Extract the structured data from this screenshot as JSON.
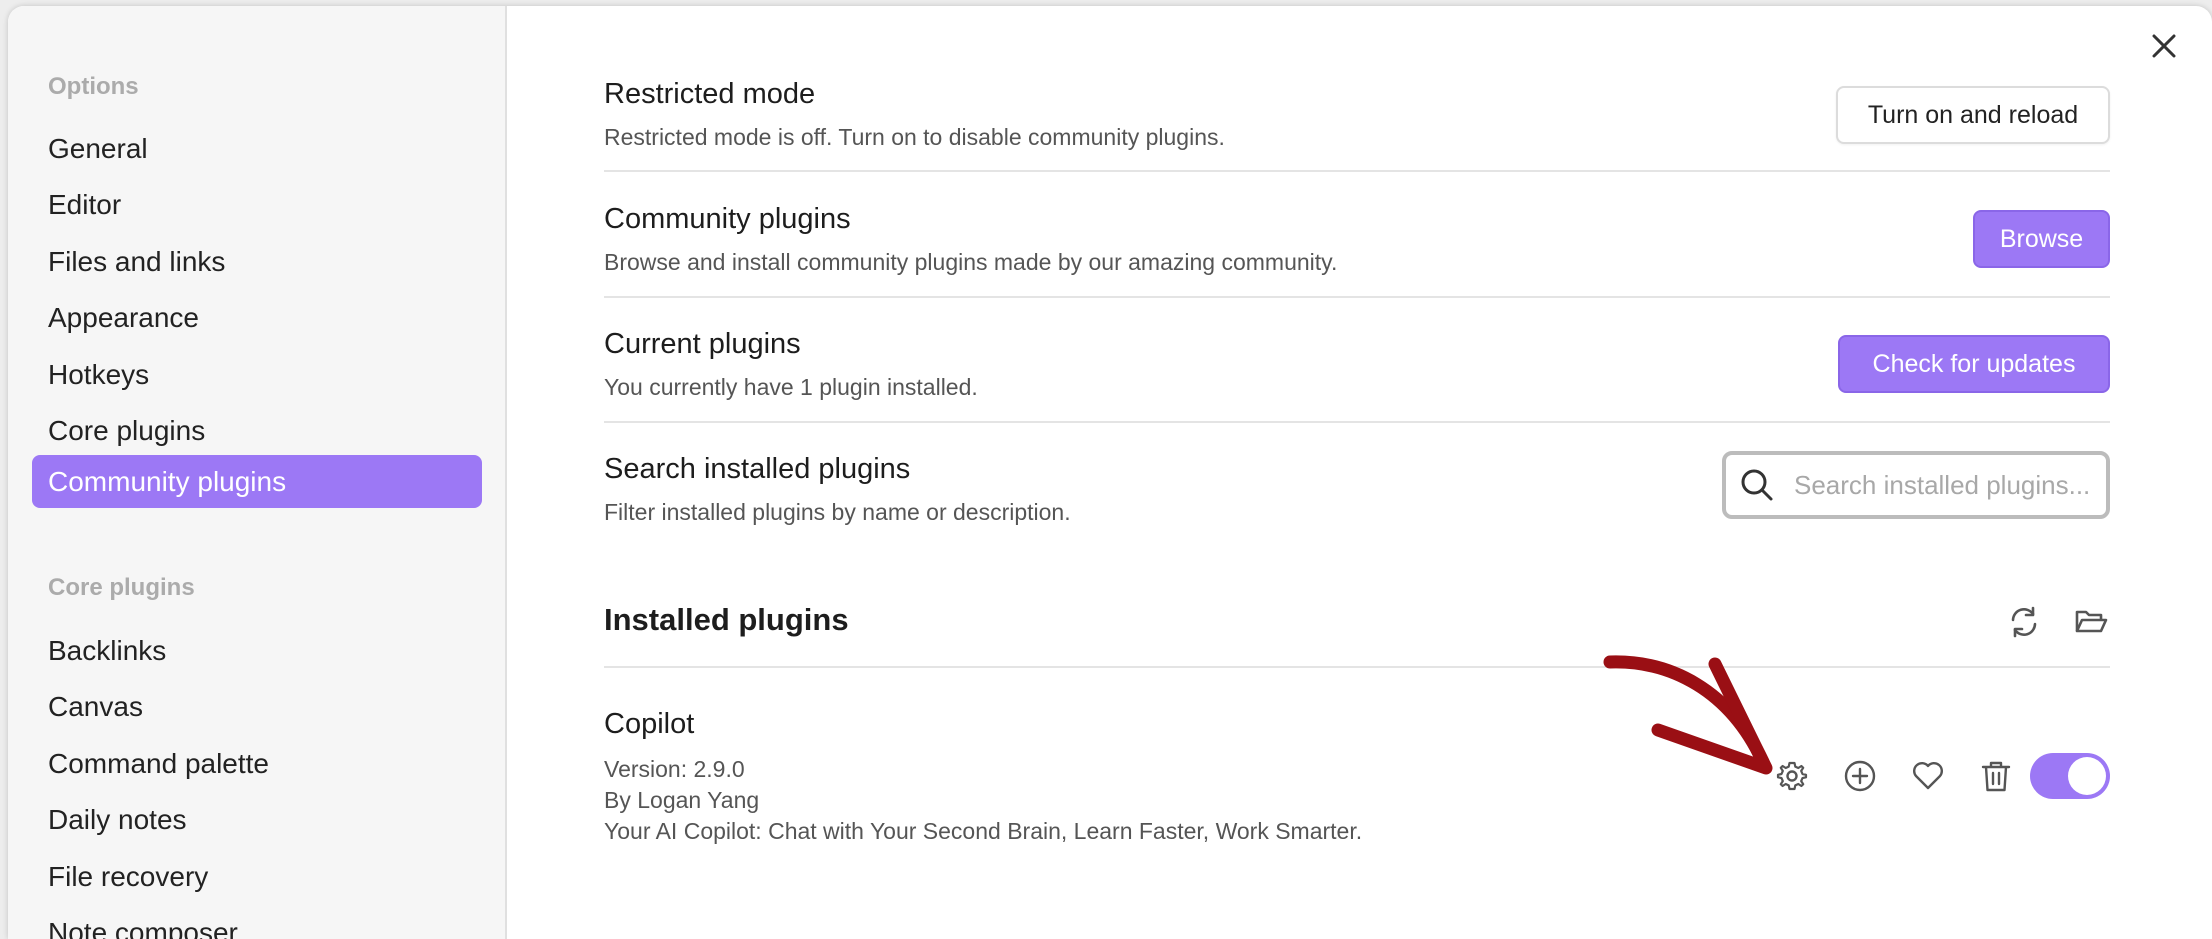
{
  "sidebar": {
    "options_heading": "Options",
    "options_items": [
      {
        "label": "General"
      },
      {
        "label": "Editor"
      },
      {
        "label": "Files and links"
      },
      {
        "label": "Appearance"
      },
      {
        "label": "Hotkeys"
      },
      {
        "label": "Core plugins"
      },
      {
        "label": "Community plugins",
        "active": true
      }
    ],
    "core_heading": "Core plugins",
    "core_items": [
      {
        "label": "Backlinks"
      },
      {
        "label": "Canvas"
      },
      {
        "label": "Command palette"
      },
      {
        "label": "Daily notes"
      },
      {
        "label": "File recovery"
      },
      {
        "label": "Note composer"
      }
    ]
  },
  "settings": {
    "restricted": {
      "name": "Restricted mode",
      "desc": "Restricted mode is off. Turn on to disable community plugins.",
      "button": "Turn on and reload"
    },
    "community": {
      "name": "Community plugins",
      "desc": "Browse and install community plugins made by our amazing community.",
      "button": "Browse"
    },
    "current": {
      "name": "Current plugins",
      "desc": "You currently have 1 plugin installed.",
      "button": "Check for updates"
    },
    "search": {
      "name": "Search installed plugins",
      "desc": "Filter installed plugins by name or description.",
      "placeholder": "Search installed plugins..."
    }
  },
  "installed": {
    "title": "Installed plugins",
    "plugins": [
      {
        "name": "Copilot",
        "version": "Version: 2.9.0",
        "author": "By Logan Yang",
        "description": "Your AI Copilot: Chat with Your Second Brain, Learn Faster, Work Smarter.",
        "enabled": true
      }
    ]
  },
  "icons": {
    "close": "close-icon",
    "search": "search-icon",
    "reload": "reload-icon",
    "folder": "folder-open-icon",
    "settings": "gear-icon",
    "hotkey": "plus-circle-icon",
    "donate": "heart-icon",
    "uninstall": "trash-icon"
  },
  "colors": {
    "accent": "#9c78f5",
    "annotation_arrow": "#9a0f14"
  }
}
